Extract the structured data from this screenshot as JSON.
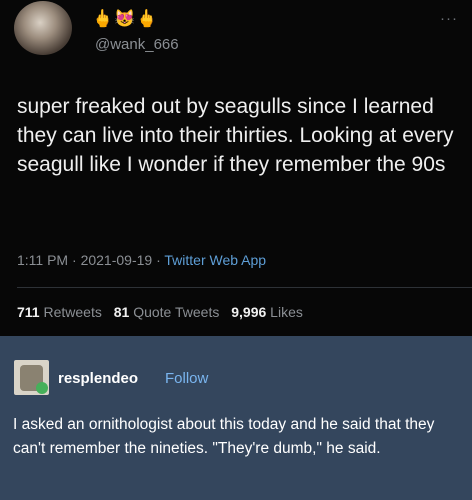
{
  "tweet": {
    "handle": "@wank_666",
    "emoji_row": "🖕😻🖕",
    "more": "···",
    "text": "super freaked out by seagulls since I learned they can live into their thirties. Looking at every seagull like I wonder if they remember the 90s",
    "time": "1:11 PM",
    "date": "2021-09-19",
    "separator": "·",
    "app": "Twitter Web App",
    "stats": {
      "retweets_count": "711",
      "retweets_label": "Retweets",
      "quotes_count": "81",
      "quotes_label": "Quote Tweets",
      "likes_count": "9,996",
      "likes_label": "Likes"
    }
  },
  "reply": {
    "username": "resplendeo",
    "follow_label": "Follow",
    "text": "I asked an ornithologist about this today and he said that they can't remember the nineties. \"They're dumb,\" he said."
  }
}
